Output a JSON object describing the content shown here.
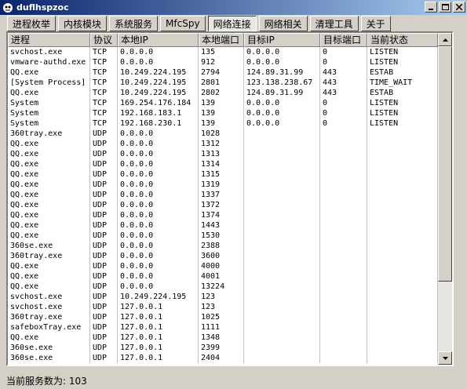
{
  "window": {
    "title": "duflhspzoc"
  },
  "tabs": [
    {
      "label": "进程枚举",
      "active": false
    },
    {
      "label": "内核模块",
      "active": false
    },
    {
      "label": "系统服务",
      "active": false
    },
    {
      "label": "MfcSpy",
      "active": false
    },
    {
      "label": "网络连接",
      "active": true
    },
    {
      "label": "网络相关",
      "active": false
    },
    {
      "label": "清理工具",
      "active": false
    },
    {
      "label": "关于",
      "active": false
    }
  ],
  "table": {
    "columns": [
      "进程",
      "协议",
      "本地IP",
      "本地端口",
      "目标IP",
      "目标端口",
      "当前状态"
    ],
    "rows": [
      [
        "svchost.exe",
        "TCP",
        "0.0.0.0",
        "135",
        "0.0.0.0",
        "0",
        "LISTEN"
      ],
      [
        "vmware-authd.exe",
        "TCP",
        "0.0.0.0",
        "912",
        "0.0.0.0",
        "0",
        "LISTEN"
      ],
      [
        "QQ.exe",
        "TCP",
        "10.249.224.195",
        "2794",
        "124.89.31.99",
        "443",
        "ESTAB"
      ],
      [
        "[System Process]",
        "TCP",
        "10.249.224.195",
        "2801",
        "123.138.238.67",
        "443",
        "TIME_WAIT"
      ],
      [
        "QQ.exe",
        "TCP",
        "10.249.224.195",
        "2802",
        "124.89.31.99",
        "443",
        "ESTAB"
      ],
      [
        "System",
        "TCP",
        "169.254.176.184",
        "139",
        "0.0.0.0",
        "0",
        "LISTEN"
      ],
      [
        "System",
        "TCP",
        "192.168.183.1",
        "139",
        "0.0.0.0",
        "0",
        "LISTEN"
      ],
      [
        "System",
        "TCP",
        "192.168.230.1",
        "139",
        "0.0.0.0",
        "0",
        "LISTEN"
      ],
      [
        "360tray.exe",
        "UDP",
        "0.0.0.0",
        "1028",
        "",
        "",
        ""
      ],
      [
        "QQ.exe",
        "UDP",
        "0.0.0.0",
        "1312",
        "",
        "",
        ""
      ],
      [
        "QQ.exe",
        "UDP",
        "0.0.0.0",
        "1313",
        "",
        "",
        ""
      ],
      [
        "QQ.exe",
        "UDP",
        "0.0.0.0",
        "1314",
        "",
        "",
        ""
      ],
      [
        "QQ.exe",
        "UDP",
        "0.0.0.0",
        "1315",
        "",
        "",
        ""
      ],
      [
        "QQ.exe",
        "UDP",
        "0.0.0.0",
        "1319",
        "",
        "",
        ""
      ],
      [
        "QQ.exe",
        "UDP",
        "0.0.0.0",
        "1337",
        "",
        "",
        ""
      ],
      [
        "QQ.exe",
        "UDP",
        "0.0.0.0",
        "1372",
        "",
        "",
        ""
      ],
      [
        "QQ.exe",
        "UDP",
        "0.0.0.0",
        "1374",
        "",
        "",
        ""
      ],
      [
        "QQ.exe",
        "UDP",
        "0.0.0.0",
        "1443",
        "",
        "",
        ""
      ],
      [
        "QQ.exe",
        "UDP",
        "0.0.0.0",
        "1530",
        "",
        "",
        ""
      ],
      [
        "360se.exe",
        "UDP",
        "0.0.0.0",
        "2388",
        "",
        "",
        ""
      ],
      [
        "360tray.exe",
        "UDP",
        "0.0.0.0",
        "3600",
        "",
        "",
        ""
      ],
      [
        "QQ.exe",
        "UDP",
        "0.0.0.0",
        "4000",
        "",
        "",
        ""
      ],
      [
        "QQ.exe",
        "UDP",
        "0.0.0.0",
        "4001",
        "",
        "",
        ""
      ],
      [
        "QQ.exe",
        "UDP",
        "0.0.0.0",
        "13224",
        "",
        "",
        ""
      ],
      [
        "svchost.exe",
        "UDP",
        "10.249.224.195",
        "123",
        "",
        "",
        ""
      ],
      [
        "svchost.exe",
        "UDP",
        "127.0.0.1",
        "123",
        "",
        "",
        ""
      ],
      [
        "360tray.exe",
        "UDP",
        "127.0.0.1",
        "1025",
        "",
        "",
        ""
      ],
      [
        "safeboxTray.exe",
        "UDP",
        "127.0.0.1",
        "1111",
        "",
        "",
        ""
      ],
      [
        "QQ.exe",
        "UDP",
        "127.0.0.1",
        "1348",
        "",
        "",
        ""
      ],
      [
        "360se.exe",
        "UDP",
        "127.0.0.1",
        "2399",
        "",
        "",
        ""
      ],
      [
        "360se.exe",
        "UDP",
        "127.0.0.1",
        "2404",
        "",
        "",
        ""
      ]
    ]
  },
  "status": {
    "label": "当前服务数为:",
    "count": "103"
  },
  "icons": {
    "app": "app-logo-icon",
    "minimize": "minimize-icon",
    "maximize": "maximize-icon",
    "close": "close-icon",
    "scroll_up": "scroll-up-icon",
    "scroll_down": "scroll-down-icon"
  },
  "colors": {
    "titlebar": "#0a246a",
    "face": "#d4d0c8"
  }
}
